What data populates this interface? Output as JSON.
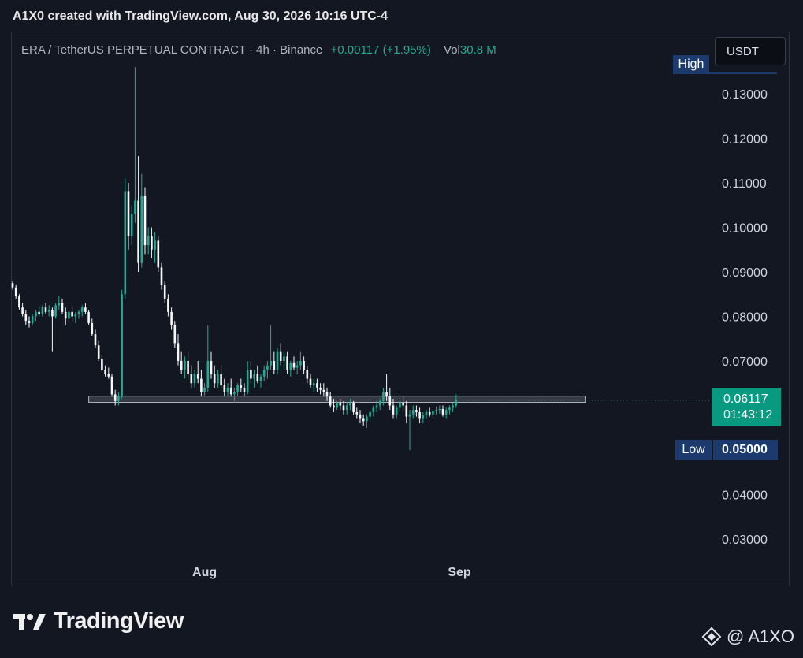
{
  "header": {
    "caption": "A1X0 created with TradingView.com, Aug 30, 2026 10:16 UTC-4"
  },
  "legend": {
    "symbol": "ERA / TetherUS PERPETUAL CONTRACT · 4h · Binance",
    "change": "+0.00117 (+1.95%)",
    "vol_label": "Vol",
    "vol_value": "30.8 M"
  },
  "currency_button": {
    "label": "USDT"
  },
  "badges": {
    "high_label": "High",
    "low_label": "Low",
    "low_value": "0.05000",
    "last_price": "0.06117",
    "countdown": "01:43:12"
  },
  "watermark": {
    "brand": "TradingView"
  },
  "author": {
    "handle": "@ A1XO"
  },
  "colors": {
    "background": "#131722",
    "up": "#22ab94",
    "down": "#f7f8fa",
    "last_price_badge": "#089981",
    "high_low_badge": "#1d3a6e",
    "support_band": "#b2b5be"
  },
  "chart_data": {
    "type": "candlestick",
    "title": "ERA / TetherUS PERPETUAL CONTRACT · 4h · Binance",
    "ylim": [
      0.025,
      0.136
    ],
    "y_ticks": [
      "0.13000",
      "0.12000",
      "0.11000",
      "0.10000",
      "0.09000",
      "0.08000",
      "0.07000",
      "0.04000",
      "0.03000"
    ],
    "x_ticks": [
      {
        "label": "Aug",
        "index": 58
      },
      {
        "label": "Sep",
        "index": 135
      }
    ],
    "support_zone": {
      "low": 0.0607,
      "high": 0.0621,
      "from_index": 23,
      "to_index": 173
    },
    "last_price": 0.06117,
    "candles": [
      [
        0.0875,
        0.088,
        0.086,
        0.0865
      ],
      [
        0.0865,
        0.087,
        0.084,
        0.0845
      ],
      [
        0.0845,
        0.085,
        0.0815,
        0.082
      ],
      [
        0.082,
        0.083,
        0.08,
        0.0805
      ],
      [
        0.0805,
        0.0815,
        0.078,
        0.079
      ],
      [
        0.079,
        0.08,
        0.0775,
        0.0785
      ],
      [
        0.0785,
        0.0805,
        0.078,
        0.08
      ],
      [
        0.08,
        0.0815,
        0.079,
        0.081
      ],
      [
        0.081,
        0.082,
        0.08,
        0.0805
      ],
      [
        0.0805,
        0.0825,
        0.08,
        0.082
      ],
      [
        0.082,
        0.083,
        0.0805,
        0.081
      ],
      [
        0.081,
        0.0825,
        0.08,
        0.0815
      ],
      [
        0.0815,
        0.082,
        0.072,
        0.08
      ],
      [
        0.08,
        0.083,
        0.0795,
        0.0825
      ],
      [
        0.0825,
        0.0845,
        0.0815,
        0.083
      ],
      [
        0.083,
        0.084,
        0.0805,
        0.081
      ],
      [
        0.081,
        0.082,
        0.078,
        0.0795
      ],
      [
        0.0795,
        0.0815,
        0.0785,
        0.081
      ],
      [
        0.081,
        0.082,
        0.079,
        0.08
      ],
      [
        0.08,
        0.081,
        0.0785,
        0.0805
      ],
      [
        0.0805,
        0.0815,
        0.0795,
        0.081
      ],
      [
        0.081,
        0.0825,
        0.08,
        0.082
      ],
      [
        0.082,
        0.083,
        0.0805,
        0.081
      ],
      [
        0.081,
        0.0815,
        0.078,
        0.0785
      ],
      [
        0.0785,
        0.0795,
        0.0755,
        0.076
      ],
      [
        0.076,
        0.077,
        0.073,
        0.0735
      ],
      [
        0.0735,
        0.0745,
        0.07,
        0.0705
      ],
      [
        0.0705,
        0.0715,
        0.0675,
        0.068
      ],
      [
        0.068,
        0.069,
        0.0665,
        0.067
      ],
      [
        0.067,
        0.0685,
        0.066,
        0.0665
      ],
      [
        0.0665,
        0.067,
        0.062,
        0.0625
      ],
      [
        0.0625,
        0.0635,
        0.06,
        0.061
      ],
      [
        0.061,
        0.063,
        0.06,
        0.062
      ],
      [
        0.062,
        0.086,
        0.0615,
        0.085
      ],
      [
        0.085,
        0.111,
        0.084,
        0.108
      ],
      [
        0.108,
        0.11,
        0.095,
        0.098
      ],
      [
        0.098,
        0.105,
        0.096,
        0.103
      ],
      [
        0.103,
        0.136,
        0.101,
        0.106
      ],
      [
        0.106,
        0.116,
        0.09,
        0.092
      ],
      [
        0.092,
        0.112,
        0.091,
        0.107
      ],
      [
        0.107,
        0.109,
        0.094,
        0.096
      ],
      [
        0.096,
        0.1,
        0.094,
        0.098
      ],
      [
        0.098,
        0.1,
        0.093,
        0.095
      ],
      [
        0.095,
        0.099,
        0.092,
        0.097
      ],
      [
        0.097,
        0.098,
        0.09,
        0.091
      ],
      [
        0.091,
        0.092,
        0.086,
        0.087
      ],
      [
        0.087,
        0.088,
        0.083,
        0.084
      ],
      [
        0.084,
        0.085,
        0.08,
        0.081
      ],
      [
        0.081,
        0.082,
        0.077,
        0.078
      ],
      [
        0.078,
        0.079,
        0.073,
        0.074
      ],
      [
        0.074,
        0.076,
        0.069,
        0.07
      ],
      [
        0.07,
        0.072,
        0.067,
        0.068
      ],
      [
        0.068,
        0.071,
        0.066,
        0.07
      ],
      [
        0.07,
        0.072,
        0.066,
        0.067
      ],
      [
        0.067,
        0.069,
        0.064,
        0.065
      ],
      [
        0.065,
        0.068,
        0.064,
        0.067
      ],
      [
        0.067,
        0.07,
        0.065,
        0.066
      ],
      [
        0.066,
        0.068,
        0.062,
        0.063
      ],
      [
        0.063,
        0.065,
        0.062,
        0.064
      ],
      [
        0.064,
        0.078,
        0.063,
        0.07
      ],
      [
        0.07,
        0.072,
        0.066,
        0.067
      ],
      [
        0.067,
        0.069,
        0.064,
        0.065
      ],
      [
        0.065,
        0.068,
        0.064,
        0.067
      ],
      [
        0.067,
        0.069,
        0.064,
        0.0645
      ],
      [
        0.0645,
        0.066,
        0.062,
        0.063
      ],
      [
        0.063,
        0.065,
        0.062,
        0.064
      ],
      [
        0.064,
        0.066,
        0.062,
        0.0625
      ],
      [
        0.0625,
        0.064,
        0.061,
        0.063
      ],
      [
        0.063,
        0.065,
        0.062,
        0.0645
      ],
      [
        0.0645,
        0.066,
        0.063,
        0.064
      ],
      [
        0.064,
        0.065,
        0.062,
        0.063
      ],
      [
        0.063,
        0.07,
        0.0625,
        0.068
      ],
      [
        0.068,
        0.07,
        0.065,
        0.066
      ],
      [
        0.066,
        0.068,
        0.064,
        0.067
      ],
      [
        0.067,
        0.069,
        0.065,
        0.0655
      ],
      [
        0.0655,
        0.067,
        0.064,
        0.0665
      ],
      [
        0.0665,
        0.069,
        0.0655,
        0.068
      ],
      [
        0.068,
        0.07,
        0.066,
        0.069
      ],
      [
        0.069,
        0.078,
        0.068,
        0.07
      ],
      [
        0.07,
        0.072,
        0.067,
        0.068
      ],
      [
        0.068,
        0.073,
        0.067,
        0.072
      ],
      [
        0.072,
        0.074,
        0.069,
        0.07
      ],
      [
        0.07,
        0.072,
        0.068,
        0.071
      ],
      [
        0.071,
        0.072,
        0.067,
        0.068
      ],
      [
        0.068,
        0.07,
        0.0665,
        0.0695
      ],
      [
        0.0695,
        0.071,
        0.068,
        0.0685
      ],
      [
        0.0685,
        0.07,
        0.067,
        0.069
      ],
      [
        0.069,
        0.072,
        0.068,
        0.07
      ],
      [
        0.07,
        0.071,
        0.067,
        0.068
      ],
      [
        0.068,
        0.069,
        0.065,
        0.066
      ],
      [
        0.066,
        0.067,
        0.064,
        0.0645
      ],
      [
        0.0645,
        0.066,
        0.063,
        0.065
      ],
      [
        0.065,
        0.066,
        0.063,
        0.064
      ],
      [
        0.064,
        0.065,
        0.0625,
        0.0635
      ],
      [
        0.0635,
        0.065,
        0.062,
        0.063
      ],
      [
        0.063,
        0.064,
        0.061,
        0.062
      ],
      [
        0.062,
        0.063,
        0.0595,
        0.06
      ],
      [
        0.06,
        0.0615,
        0.0585,
        0.0595
      ],
      [
        0.0595,
        0.061,
        0.059,
        0.0605
      ],
      [
        0.0605,
        0.0615,
        0.059,
        0.06
      ],
      [
        0.06,
        0.061,
        0.058,
        0.059
      ],
      [
        0.059,
        0.0605,
        0.058,
        0.06
      ],
      [
        0.06,
        0.0615,
        0.059,
        0.0605
      ],
      [
        0.0605,
        0.061,
        0.058,
        0.0585
      ],
      [
        0.0585,
        0.0595,
        0.057,
        0.058
      ],
      [
        0.058,
        0.059,
        0.056,
        0.057
      ],
      [
        0.057,
        0.058,
        0.0555,
        0.0565
      ],
      [
        0.0565,
        0.058,
        0.055,
        0.0575
      ],
      [
        0.0575,
        0.059,
        0.0565,
        0.0585
      ],
      [
        0.0585,
        0.06,
        0.0575,
        0.0595
      ],
      [
        0.0595,
        0.061,
        0.0585,
        0.06
      ],
      [
        0.06,
        0.0615,
        0.059,
        0.061
      ],
      [
        0.061,
        0.064,
        0.06,
        0.063
      ],
      [
        0.063,
        0.067,
        0.061,
        0.062
      ],
      [
        0.062,
        0.064,
        0.059,
        0.06
      ],
      [
        0.06,
        0.0615,
        0.057,
        0.058
      ],
      [
        0.058,
        0.06,
        0.057,
        0.0595
      ],
      [
        0.0595,
        0.0615,
        0.0585,
        0.0605
      ],
      [
        0.0605,
        0.062,
        0.059,
        0.06
      ],
      [
        0.06,
        0.061,
        0.056,
        0.0575
      ],
      [
        0.0575,
        0.059,
        0.05,
        0.058
      ],
      [
        0.058,
        0.06,
        0.057,
        0.059
      ],
      [
        0.059,
        0.06,
        0.0575,
        0.0585
      ],
      [
        0.0585,
        0.0595,
        0.056,
        0.057
      ],
      [
        0.057,
        0.0585,
        0.056,
        0.0578
      ],
      [
        0.0578,
        0.059,
        0.057,
        0.0585
      ],
      [
        0.0585,
        0.0595,
        0.0575,
        0.058
      ],
      [
        0.058,
        0.0592,
        0.0572,
        0.0588
      ],
      [
        0.0588,
        0.0598,
        0.058,
        0.059
      ],
      [
        0.059,
        0.06,
        0.0582,
        0.0592
      ],
      [
        0.0592,
        0.06,
        0.0575,
        0.058
      ],
      [
        0.058,
        0.0595,
        0.057,
        0.059
      ],
      [
        0.059,
        0.06,
        0.058,
        0.0595
      ],
      [
        0.0595,
        0.0605,
        0.0585,
        0.06
      ],
      [
        0.06,
        0.0625,
        0.0595,
        0.0612
      ]
    ]
  }
}
